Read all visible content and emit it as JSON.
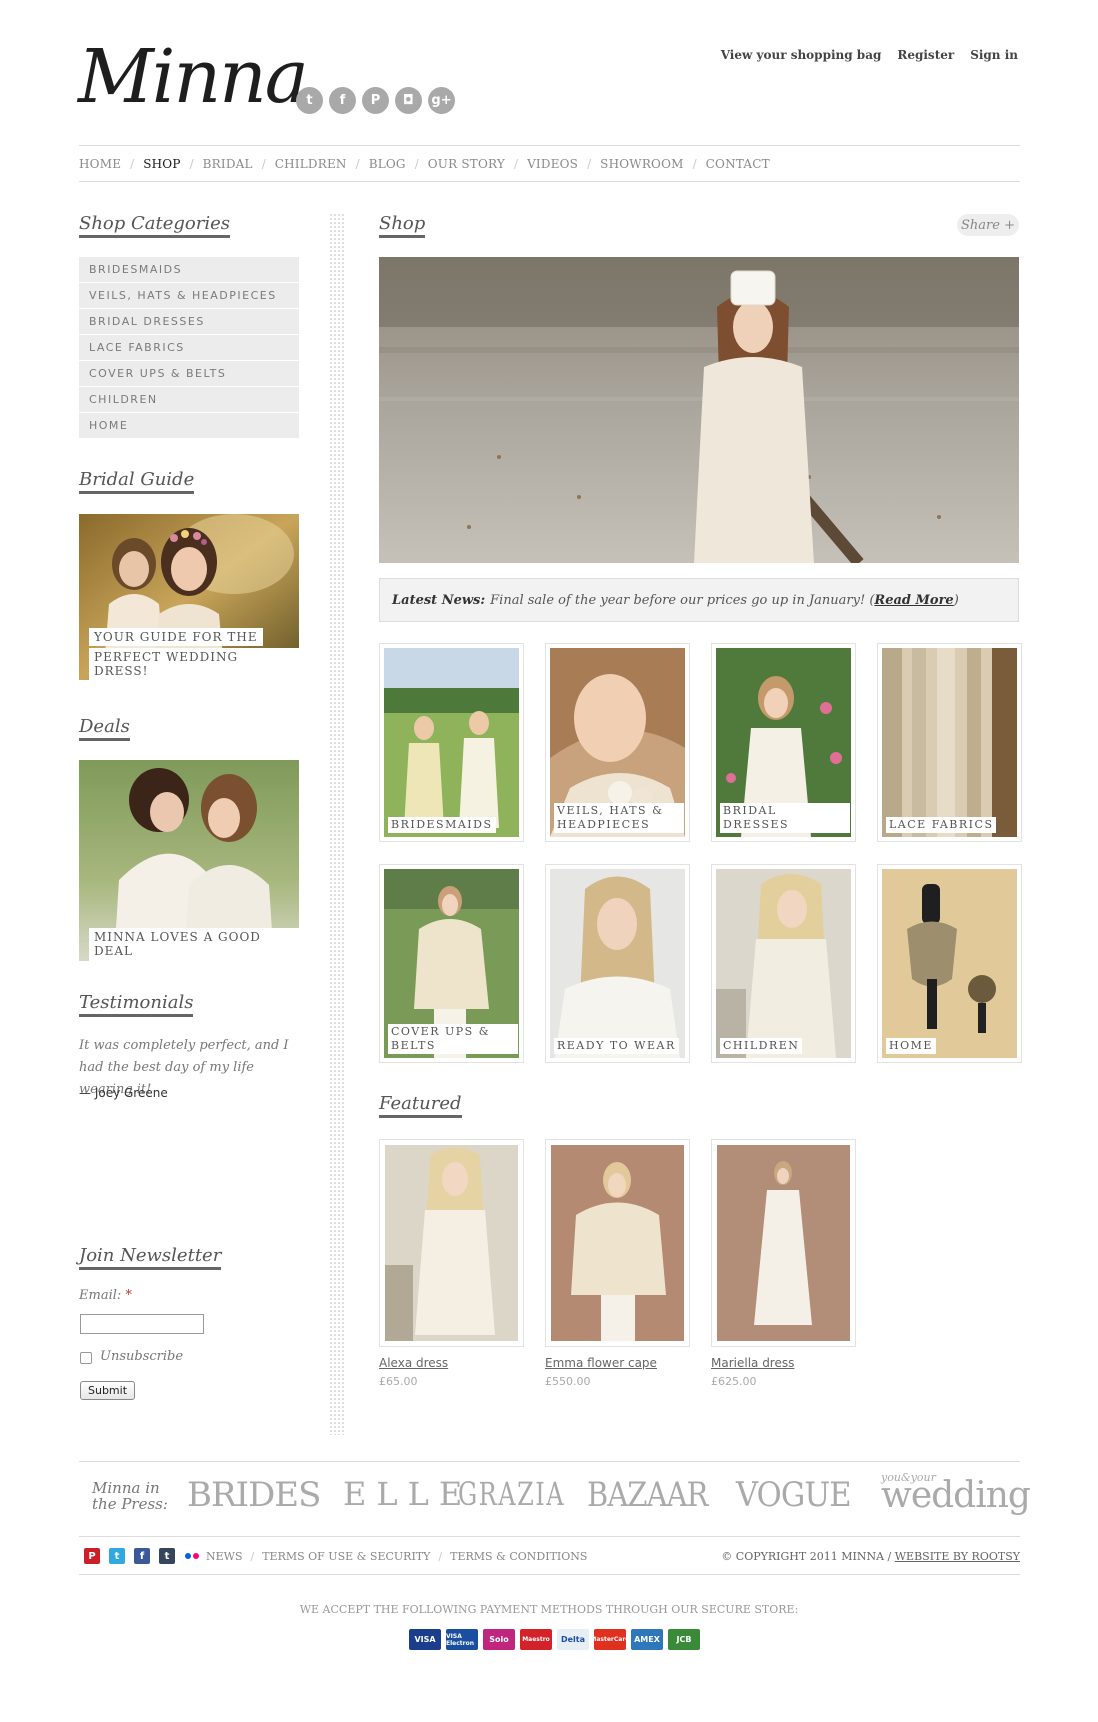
{
  "brand": {
    "logo_text": "Minna"
  },
  "social_icons": [
    "twitter-icon",
    "facebook-icon",
    "pinterest-icon",
    "instagram-icon",
    "googleplus-icon"
  ],
  "top_links": {
    "bag": "View your shopping bag",
    "register": "Register",
    "signin": "Sign in"
  },
  "nav": [
    "HOME",
    "SHOP",
    "BRIDAL",
    "CHILDREN",
    "BLOG",
    "OUR STORY",
    "VIDEOS",
    "SHOWROOM",
    "CONTACT"
  ],
  "nav_active": "SHOP",
  "sidebar": {
    "categories_title": "Shop Categories",
    "categories": [
      "Bridesmaids",
      "Veils, hats & headpieces",
      "Bridal dresses",
      "Lace fabrics",
      "Cover ups & belts",
      "Children",
      "Home"
    ],
    "bridal_guide_title": "Bridal Guide",
    "bridal_guide_caption_1": "YOUR GUIDE FOR THE",
    "bridal_guide_caption_2": "PERFECT WEDDING DRESS!",
    "deals_title": "Deals",
    "deals_caption": "MINNA LOVES A GOOD DEAL",
    "testimonials_title": "Testimonials",
    "testimonial_text": "It was completely perfect, and I had the best day of my life wearing it!",
    "testimonial_author": "— Joey Greene",
    "newsletter_title": "Join Newsletter",
    "email_label": "Email:",
    "required_mark": "*",
    "unsubscribe_label": "Unsubscribe",
    "submit_label": "Submit"
  },
  "main": {
    "shop_title": "Shop",
    "share_label": "Share +",
    "news_label": "Latest News:",
    "news_text": "Final sale of the year before our prices go up in January! (",
    "news_link": "Read More",
    "news_close": ")",
    "tiles": [
      {
        "label": "Bridesmaids"
      },
      {
        "label": "Veils, hats & headpieces"
      },
      {
        "label": "Bridal dresses"
      },
      {
        "label": "Lace fabrics"
      },
      {
        "label": "Cover ups & belts"
      },
      {
        "label": "Ready to wear"
      },
      {
        "label": "Children"
      },
      {
        "label": "Home"
      }
    ],
    "featured_title": "Featured",
    "featured": [
      {
        "name": "Alexa dress",
        "price": "£65.00"
      },
      {
        "name": "Emma flower cape",
        "price": "£550.00"
      },
      {
        "name": "Mariella dress",
        "price": "£625.00"
      }
    ]
  },
  "footer": {
    "press_intro": "Minna in the Press:",
    "press": [
      "BRIDES",
      "ELLE",
      "GRAZIA",
      "BAZAAR",
      "VOGUE",
      "wedding"
    ],
    "press_wedding_prefix": "you&your",
    "links": [
      "NEWS",
      "TERMS OF USE & SECURITY",
      "TERMS & CONDITIONS"
    ],
    "copyright": "© COPYRIGHT 2011 MINNA /",
    "credit": "WEBSITE BY ROOTSY",
    "payment_line": "WE ACCEPT THE FOLLOWING PAYMENT METHODS THROUGH OUR SECURE STORE:",
    "payment_cards": [
      "VISA",
      "VISA Electron",
      "Solo",
      "Maestro",
      "Delta",
      "MasterCard",
      "AMEX",
      "JCB"
    ]
  }
}
